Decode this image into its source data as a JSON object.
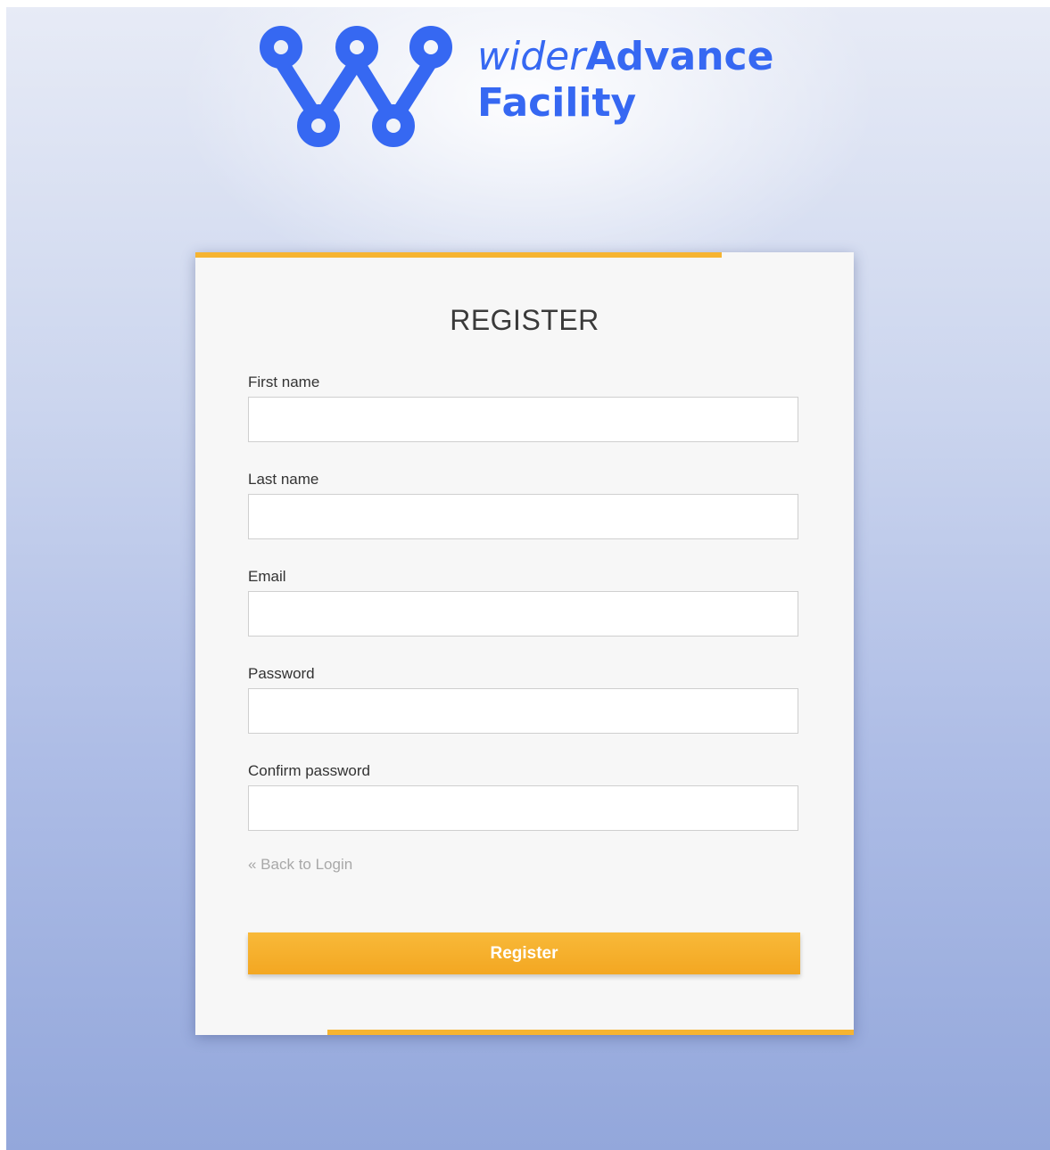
{
  "brand": {
    "logo_icon": "w-node-logo-icon",
    "name_part1": "wider",
    "name_part2": "Advance",
    "name_line2": "Facility",
    "color": "#3668f2"
  },
  "form": {
    "title": "REGISTER",
    "fields": [
      {
        "label": "First name",
        "value": "",
        "placeholder": ""
      },
      {
        "label": "Last name",
        "value": "",
        "placeholder": ""
      },
      {
        "label": "Email",
        "value": "",
        "placeholder": ""
      },
      {
        "label": "Password",
        "value": "",
        "placeholder": ""
      },
      {
        "label": "Confirm password",
        "value": "",
        "placeholder": ""
      }
    ],
    "back_link": "« Back to Login",
    "submit_label": "Register",
    "accent_color": "#f6b431"
  }
}
